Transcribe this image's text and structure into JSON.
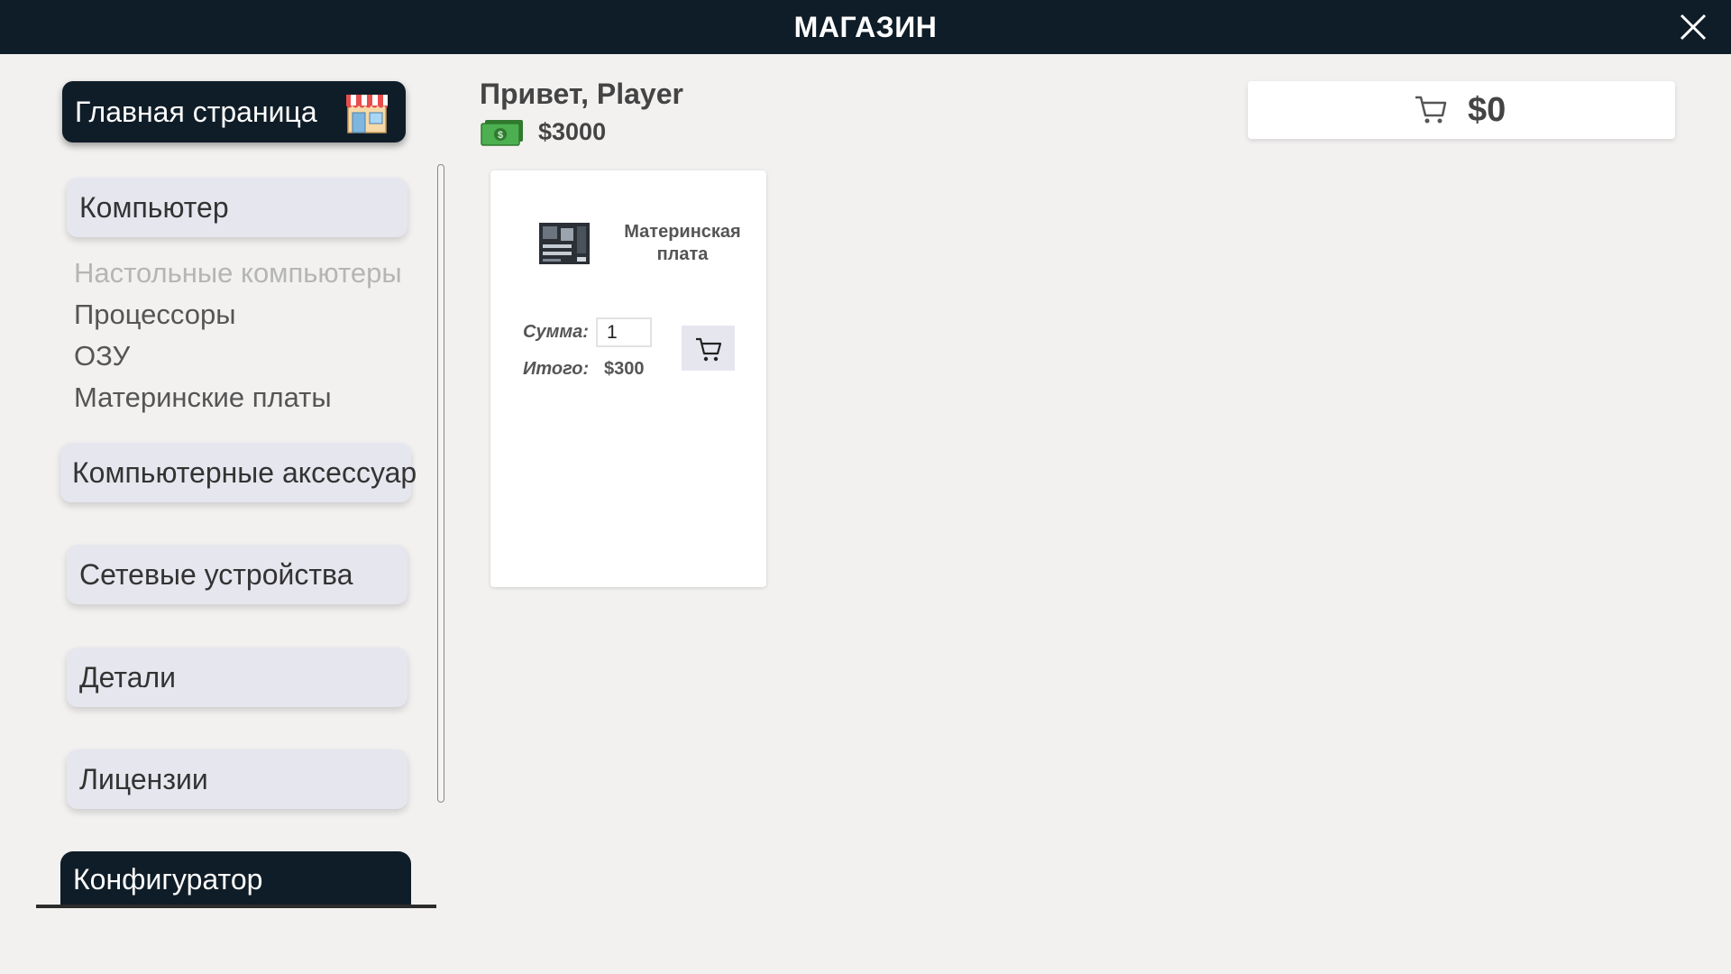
{
  "window": {
    "title": "МАГАЗИН",
    "close_icon": "close-icon"
  },
  "sidebar": {
    "home_label": "Главная страница",
    "home_icon": "shop-icon",
    "categories": [
      {
        "label": "Компьютер"
      },
      {
        "label": "Компьютерные аксессуар"
      },
      {
        "label": "Сетевые устройства"
      },
      {
        "label": "Детали"
      },
      {
        "label": "Лицензии"
      }
    ],
    "subcategories": [
      {
        "label": "Настольные компьютеры",
        "disabled": true
      },
      {
        "label": "Процессоры"
      },
      {
        "label": "ОЗУ"
      },
      {
        "label": "Материнские платы"
      }
    ],
    "configurator_label": "Конфигуратор"
  },
  "header": {
    "greeting": "Привет, Player",
    "balance": "$3000",
    "money_icon": "money-icon"
  },
  "cart": {
    "icon": "cart-icon",
    "total": "$0"
  },
  "products": [
    {
      "name": "Материнская плата",
      "sum_label": "Сумма:",
      "quantity": "1",
      "total_label": "Итого:",
      "total": "$300",
      "add_icon": "cart-icon"
    }
  ],
  "colors": {
    "dark": "#0f1d28",
    "category_bg": "#e6e6ef",
    "page_bg": "#f2f1f0",
    "money_green": "#3a8a3a"
  }
}
